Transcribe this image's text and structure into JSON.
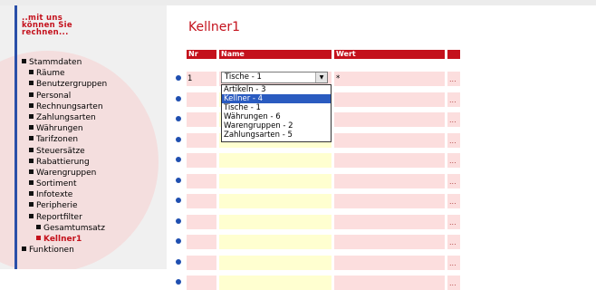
{
  "logo": {
    "line1": "..mit uns",
    "line2": "können Sie",
    "line3": "rechnen..."
  },
  "nav": [
    {
      "label": "Stammdaten",
      "level": 1,
      "active": false
    },
    {
      "label": "Räume",
      "level": 2,
      "active": false
    },
    {
      "label": "Benutzergruppen",
      "level": 2,
      "active": false
    },
    {
      "label": "Personal",
      "level": 2,
      "active": false
    },
    {
      "label": "Rechnungsarten",
      "level": 2,
      "active": false
    },
    {
      "label": "Zahlungsarten",
      "level": 2,
      "active": false
    },
    {
      "label": "Währungen",
      "level": 2,
      "active": false
    },
    {
      "label": "Tarifzonen",
      "level": 2,
      "active": false
    },
    {
      "label": "Steuersätze",
      "level": 2,
      "active": false
    },
    {
      "label": "Rabattierung",
      "level": 2,
      "active": false
    },
    {
      "label": "Warengruppen",
      "level": 2,
      "active": false
    },
    {
      "label": "Sortiment",
      "level": 2,
      "active": false
    },
    {
      "label": "Infotexte",
      "level": 2,
      "active": false
    },
    {
      "label": "Peripherie",
      "level": 2,
      "active": false
    },
    {
      "label": "Reportfilter",
      "level": 2,
      "active": false
    },
    {
      "label": "Gesamtumsatz",
      "level": 3,
      "active": false
    },
    {
      "label": "Kellner1",
      "level": 3,
      "active": true
    },
    {
      "label": "Funktionen",
      "level": 1,
      "active": false
    }
  ],
  "page": {
    "title": "Kellner1"
  },
  "table": {
    "headers": {
      "nr": "Nr",
      "name": "Name",
      "wert": "Wert",
      "action": ""
    },
    "first_row": {
      "nr": "1",
      "name_select": "Tische - 1",
      "wert": "*",
      "action": "..."
    },
    "empty_row_action": "...",
    "empty_row_count": 10,
    "dropdown_options": [
      {
        "label": "Artikeln - 3",
        "selected": false
      },
      {
        "label": "Kellner - 4",
        "selected": true
      },
      {
        "label": "Tische - 1",
        "selected": false
      },
      {
        "label": "Währungen - 6",
        "selected": false
      },
      {
        "label": "Warengruppen - 2",
        "selected": false
      },
      {
        "label": "Zahlungsarten - 5",
        "selected": false
      }
    ]
  },
  "colors": {
    "accent": "#c4111c",
    "bullet": "#1f4fb0",
    "row_pink": "#fcdede",
    "row_yellow": "#ffffd0",
    "select_highlight": "#2a5bc0"
  }
}
